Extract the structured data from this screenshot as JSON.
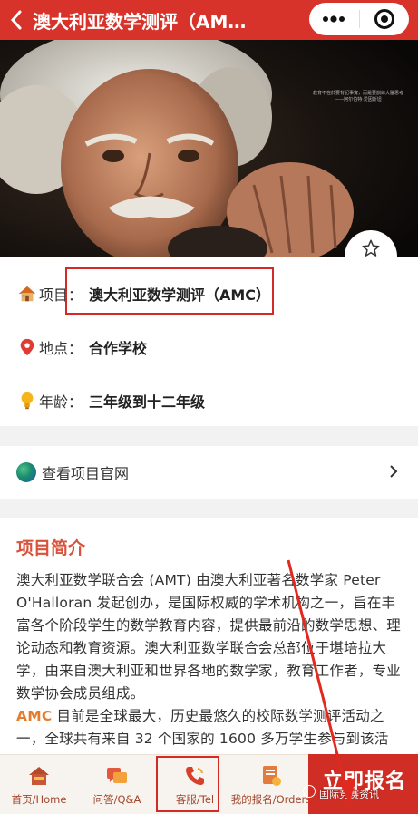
{
  "header": {
    "title": "澳大利亚数学测评（AM…"
  },
  "hero": {
    "quote_lines": [
      "教育不在於要背記事實，而是要訓練大腦思考",
      "——阿尔伯特·爱因斯坦"
    ]
  },
  "favorite": {
    "label": "收藏"
  },
  "info": {
    "project": {
      "label": "项目：",
      "value": "澳大利亚数学测评（AMC）"
    },
    "location": {
      "label": "地点：",
      "value": "合作学校"
    },
    "age": {
      "label": "年龄：",
      "value": "三年级到十二年级"
    }
  },
  "website": {
    "label": "查看项目官网"
  },
  "intro": {
    "heading": "项目简介",
    "p1": "澳大利亚数学联合会 (AMT) 由澳大利亚著名数学家 Peter O'Halloran 发起创办，是国际权威的学术机构之一，旨在丰富各个阶段学生的数学教育内容，提供最前沿的数学思想、理论动态和教育资源。澳大利亚数学联合会总部位于堪培拉大学，由来自澳大利亚和世界各地的数学家，教育工作者，专业数学协会成员组成。",
    "p2_highlight": "AMC",
    "p2": " 目前是全球最大，历史最悠久的校际数学测评活动之一，全球共有来自 32 个国家的 1600 多万学生参与到该活"
  },
  "tabbar": {
    "items": [
      {
        "label": "首页/Home",
        "icon": "home-icon"
      },
      {
        "label": "问答/Q&A",
        "icon": "chat-icon"
      },
      {
        "label": "客服/Tel",
        "icon": "phone-icon"
      },
      {
        "label": "我的报名/Orders",
        "icon": "orders-icon"
      }
    ],
    "signup_label": "立即报名",
    "watermark": "国际竞赛资讯"
  },
  "colors": {
    "brand_red": "#d8332b",
    "heading_orange": "#d8533a",
    "highlight_orange": "#e57b2c",
    "tab_text": "#a1452d"
  }
}
